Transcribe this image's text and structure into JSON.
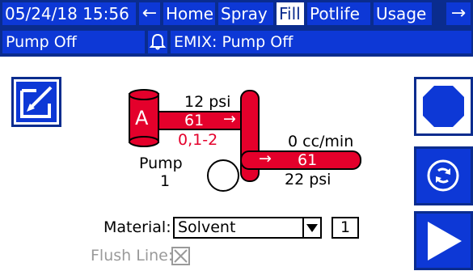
{
  "topbar": {
    "datetime": "05/24/18 15:56",
    "back_arrow": "←",
    "tabs": [
      {
        "label": "Home",
        "active": false
      },
      {
        "label": "Spray",
        "active": false
      },
      {
        "label": "Fill",
        "active": true
      },
      {
        "label": "Potlife",
        "active": false
      },
      {
        "label": "Usage",
        "active": false
      }
    ],
    "forward_arrow": "→"
  },
  "statusbar": {
    "pump_status": "Pump Off",
    "alarm_icon": "bell-icon",
    "alarm_message": "EMIX: Pump Off"
  },
  "diagram": {
    "component_label": "A",
    "inlet_pressure": "12 psi",
    "inlet_flow_value": "61",
    "inlet_arrow": "→",
    "inlet_setting": "0,1-2",
    "outlet_flow": "0 cc/min",
    "outlet_arrow": "→",
    "outlet_flow_value": "61",
    "outlet_pressure": "22 psi",
    "pump_label": "Pump",
    "pump_number": "1"
  },
  "material": {
    "label": "Material:",
    "value": "Solvent",
    "count": "1"
  },
  "flush": {
    "label": "Flush Line:",
    "checked": false
  },
  "colors": {
    "header_dark": "#0a2c8e",
    "header_box": "#0d38d6",
    "pipe_red": "#e4002b",
    "disabled_grey": "#9a9a9a"
  },
  "icons": {
    "edit": "edit-icon",
    "stop": "stop-icon",
    "cycle": "cycle-icon",
    "play": "play-icon"
  }
}
